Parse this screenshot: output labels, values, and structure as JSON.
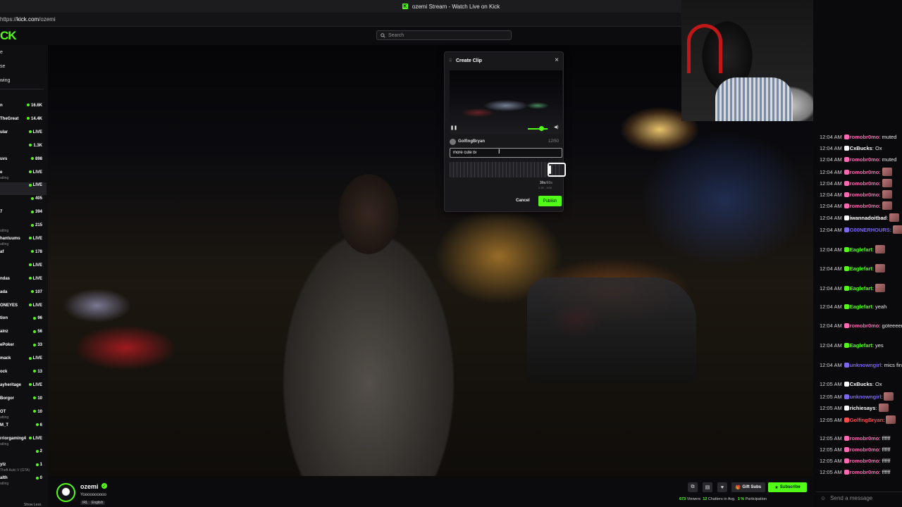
{
  "browser": {
    "tab_title": "ozemi Stream - Watch Live on Kick",
    "url_prefix": "https://",
    "url_host": "kick.com",
    "url_path": "/ozemi"
  },
  "header": {
    "logo": "CK",
    "search_placeholder": "Search"
  },
  "sidebar": {
    "nav": [
      "e",
      "se",
      "wing"
    ],
    "channels": [
      {
        "name": "n",
        "sub": "",
        "viewers": "16.6K"
      },
      {
        "name": "TheGreat",
        "sub": "",
        "viewers": "14.4K"
      },
      {
        "name": "ular",
        "sub": "",
        "viewers": "LIVE"
      },
      {
        "name": "",
        "sub": "",
        "viewers": "1.3K"
      },
      {
        "name": "uvs",
        "sub": "",
        "viewers": "898"
      },
      {
        "name": "e",
        "sub": "atting",
        "viewers": "LIVE"
      },
      {
        "name": "",
        "sub": "",
        "viewers": "LIVE"
      },
      {
        "name": "",
        "sub": "",
        "viewers": "405"
      },
      {
        "name": "7",
        "sub": "",
        "viewers": "394"
      },
      {
        "name": "",
        "sub": "atting",
        "viewers": "215"
      },
      {
        "name": "hantuums",
        "sub": "atting",
        "viewers": "LIVE"
      },
      {
        "name": "af",
        "sub": "",
        "viewers": "178"
      },
      {
        "name": "",
        "sub": "",
        "viewers": "LIVE"
      },
      {
        "name": "ndas",
        "sub": "",
        "viewers": "LIVE"
      },
      {
        "name": "ada",
        "sub": "",
        "viewers": "107"
      },
      {
        "name": "ONEYES",
        "sub": "",
        "viewers": "LIVE"
      },
      {
        "name": "tion",
        "sub": "",
        "viewers": "96"
      },
      {
        "name": "ainz",
        "sub": "",
        "viewers": "56"
      },
      {
        "name": "ePoker",
        "sub": "",
        "viewers": "33"
      },
      {
        "name": "mack",
        "sub": "",
        "viewers": "LIVE"
      },
      {
        "name": "ock",
        "sub": "",
        "viewers": "13"
      },
      {
        "name": "ayheritage",
        "sub": "",
        "viewers": "LIVE"
      },
      {
        "name": "Borgor",
        "sub": "",
        "viewers": "10"
      },
      {
        "name": "OT",
        "sub": "atting",
        "viewers": "10"
      },
      {
        "name": "M_T",
        "sub": "",
        "viewers": "6"
      },
      {
        "name": "rriorgaming4",
        "sub": "atting",
        "viewers": "LIVE"
      },
      {
        "name": "",
        "sub": "",
        "viewers": "2"
      },
      {
        "name": "ytz",
        "sub": "Theft Auto V (GTA)",
        "viewers": "1"
      },
      {
        "name": "alth",
        "sub": "atting",
        "viewers": "0"
      }
    ],
    "show_less": "Show Less"
  },
  "clip_dialog": {
    "title": "Create Clip",
    "author": "GolfingBryan",
    "char_count": "12/50",
    "input_value": "more cute bi",
    "duration": "30s",
    "duration_suffix": "/60s",
    "range": "2:30 - 3:00",
    "cancel_label": "Cancel",
    "publish_label": "Publish"
  },
  "channel": {
    "name": "ozemi",
    "title": "Yoooooooooo",
    "tags": [
      "IRL",
      "English"
    ],
    "gift_label": "Gift Subs",
    "subscribe_label": "Subscribe",
    "viewers": "673",
    "viewers_label": "Viewers",
    "chatters": "12",
    "chatters_label": "Chatters in Avg.",
    "participation": "1 %",
    "participation_label": "Participation"
  },
  "chat": {
    "messages": [
      {
        "time": "12:04 AM",
        "user": "romobr0mo",
        "color": "#ff69b4",
        "text": "muted"
      },
      {
        "time": "12:04 AM",
        "user": "CxBucks",
        "color": "#ffffff",
        "text": "Ox"
      },
      {
        "time": "12:04 AM",
        "user": "romobr0mo",
        "color": "#ff69b4",
        "text": "muted"
      },
      {
        "time": "12:04 AM",
        "user": "romobr0mo",
        "color": "#ff69b4",
        "text": ""
      },
      {
        "time": "12:04 AM",
        "user": "romobr0mo",
        "color": "#ff69b4",
        "text": ""
      },
      {
        "time": "12:04 AM",
        "user": "romobr0mo",
        "color": "#ff69b4",
        "text": ""
      },
      {
        "time": "12:04 AM",
        "user": "romobr0mo",
        "color": "#ff69b4",
        "text": ""
      },
      {
        "time": "12:04 AM",
        "user": "iwannadoitbad",
        "color": "#ffffff",
        "text": ""
      },
      {
        "time": "12:04 AM",
        "user": "G00NERHOURS",
        "color": "#7b68ee",
        "text": ""
      },
      {
        "time": "12:04 AM",
        "user": "Eaglefart",
        "color": "#53fc18",
        "text": ""
      },
      {
        "time": "12:04 AM",
        "user": "Eaglefart",
        "color": "#53fc18",
        "text": ""
      },
      {
        "time": "12:04 AM",
        "user": "Eaglefart",
        "color": "#53fc18",
        "text": ""
      },
      {
        "time": "12:04 AM",
        "user": "Eaglefart",
        "color": "#53fc18",
        "text": "yeah"
      },
      {
        "time": "12:04 AM",
        "user": "romobr0mo",
        "color": "#ff69b4",
        "text": "goteeeem"
      },
      {
        "time": "12:04 AM",
        "user": "Eaglefart",
        "color": "#53fc18",
        "text": "yes"
      },
      {
        "time": "12:04 AM",
        "user": "unknowngirl",
        "color": "#7b68ee",
        "text": "mics fine"
      },
      {
        "time": "12:05 AM",
        "user": "CxBucks",
        "color": "#ffffff",
        "text": "Ox"
      },
      {
        "time": "12:05 AM",
        "user": "unknowngirl",
        "color": "#7b68ee",
        "text": ""
      },
      {
        "time": "12:05 AM",
        "user": "richiesays",
        "color": "#ffffff",
        "text": ""
      },
      {
        "time": "12:05 AM",
        "user": "GolfingBryan",
        "color": "#ff4d4d",
        "text": ""
      },
      {
        "time": "12:05 AM",
        "user": "romobr0mo",
        "color": "#ff69b4",
        "text": "ffffff"
      },
      {
        "time": "12:05 AM",
        "user": "romobr0mo",
        "color": "#ff69b4",
        "text": "ffffff"
      },
      {
        "time": "12:05 AM",
        "user": "romobr0mo",
        "color": "#ff69b4",
        "text": "ffffff"
      },
      {
        "time": "12:05 AM",
        "user": "romobr0mo",
        "color": "#ff69b4",
        "text": "ffffff"
      }
    ],
    "input_placeholder": "Send a message"
  },
  "colors": {
    "accent": "#53fc18",
    "background": "#0b0b0d",
    "panel": "#18181b"
  }
}
